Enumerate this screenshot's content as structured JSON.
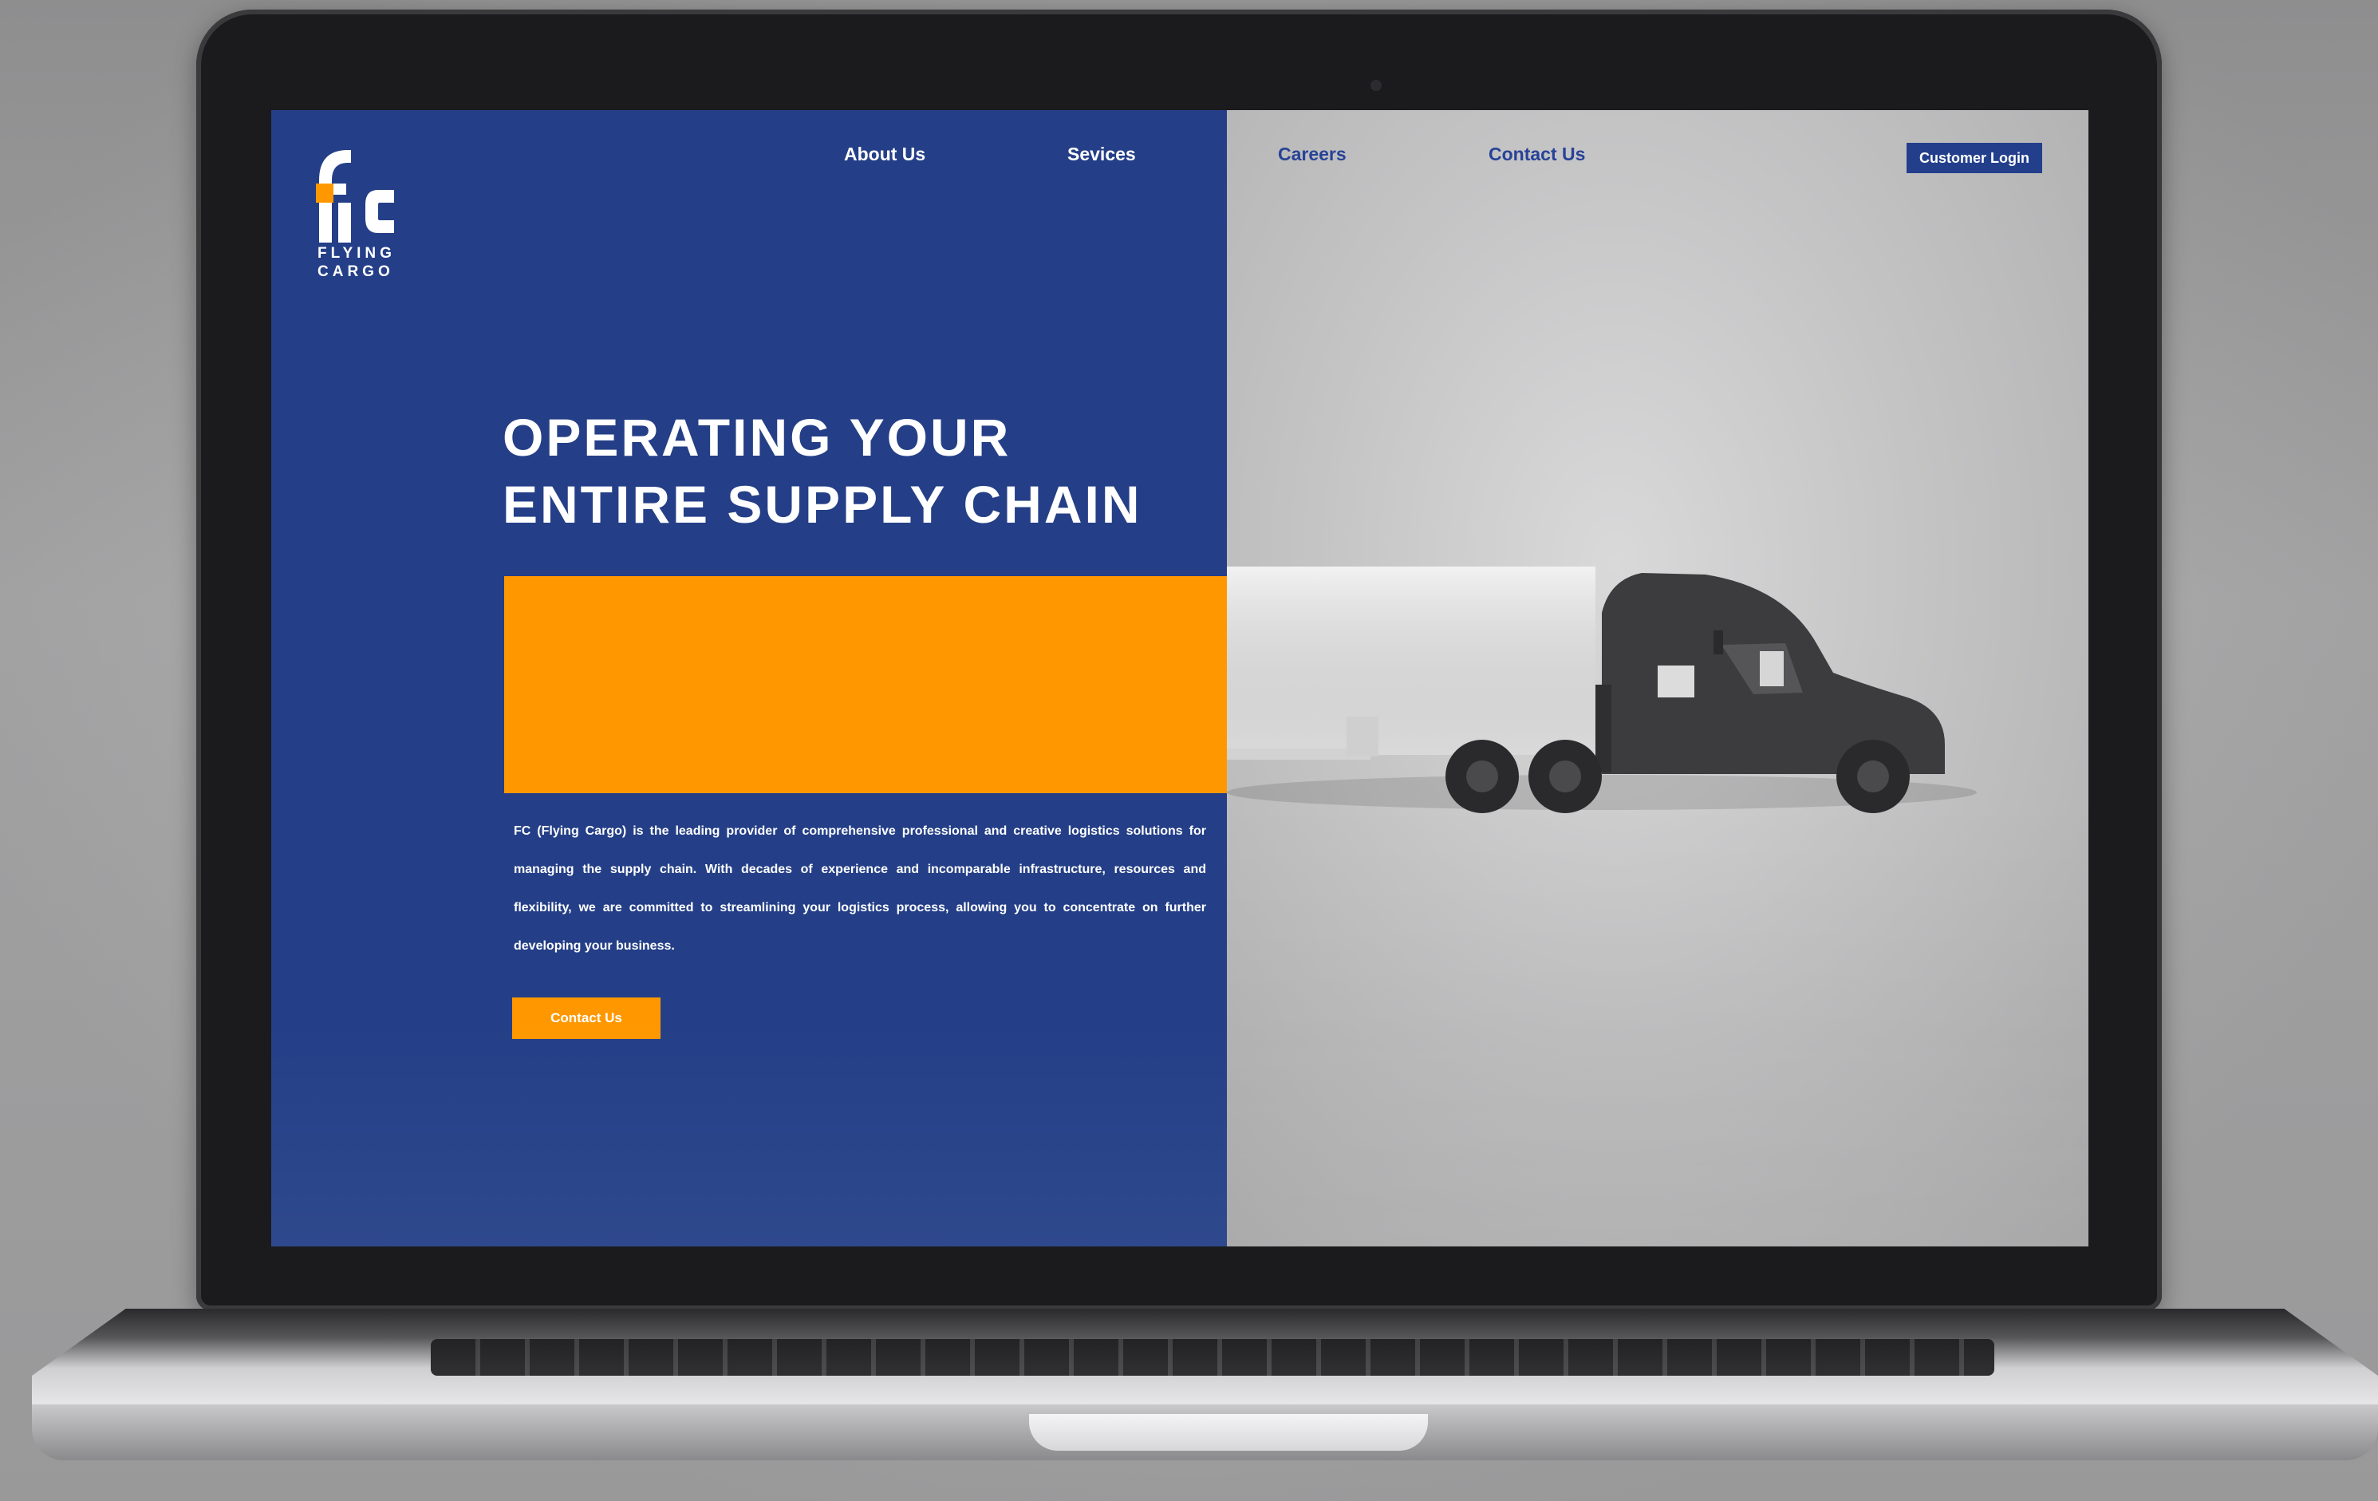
{
  "brand": {
    "logo_letters": "fc",
    "name_line1": "FLYING",
    "name_line2": "CARGO",
    "color_blue": "#243f87",
    "color_orange": "#ff9800"
  },
  "nav": {
    "items": [
      {
        "label": "About Us"
      },
      {
        "label": "Sevices"
      },
      {
        "label": "Careers"
      },
      {
        "label": "Contact Us"
      }
    ],
    "login_label": "Customer Login"
  },
  "hero": {
    "headline_line1": "OPERATING YOUR",
    "headline_line2": "ENTIRE SUPPLY CHAIN",
    "description": "FC (Flying Cargo) is the leading provider of comprehensive professional and creative logistics solutions for managing the supply chain. With decades of experience and incomparable infrastructure, resources and flexibility, we are committed to streamlining your logistics process, allowing you to concentrate on further developing your business.",
    "cta_label": "Contact Us",
    "image": "semi-truck-icon"
  }
}
